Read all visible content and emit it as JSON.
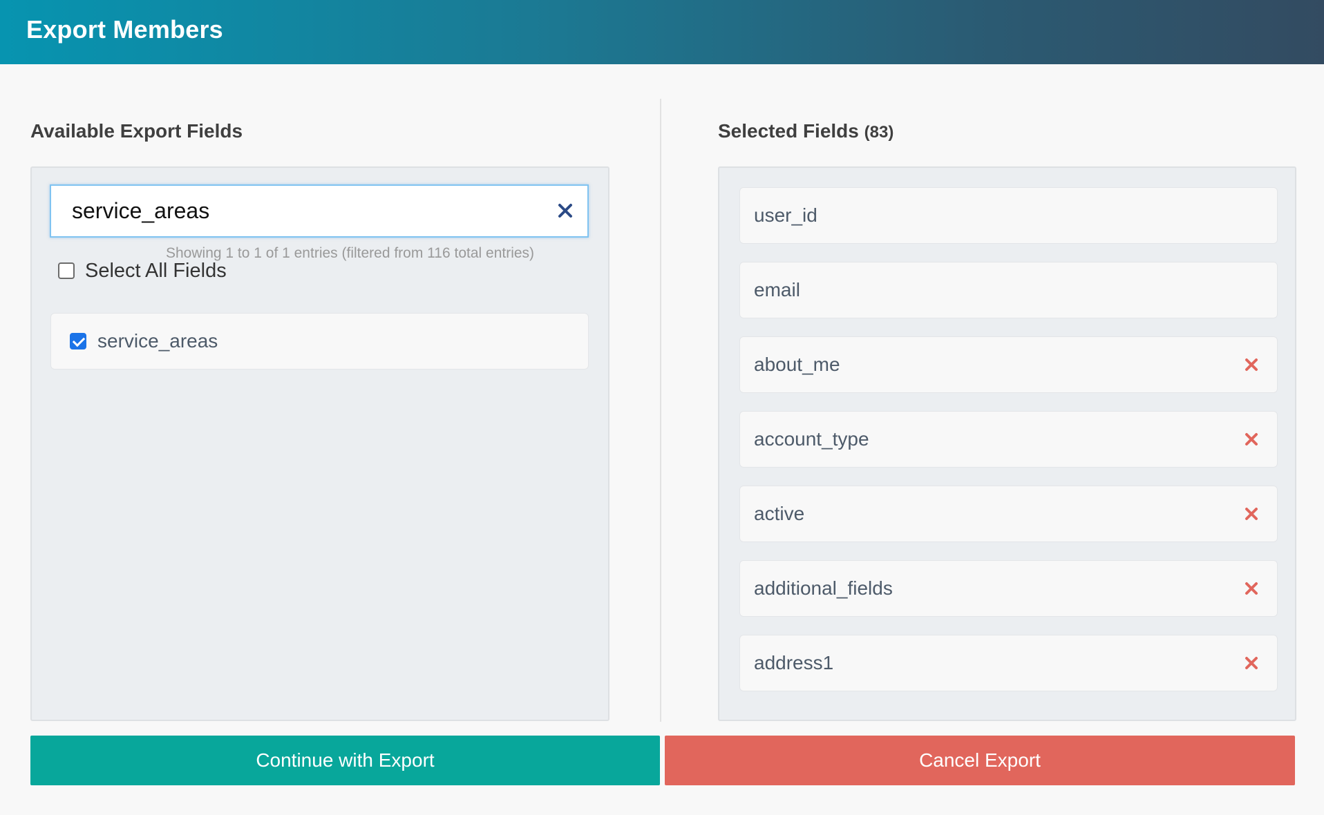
{
  "header": {
    "title": "Export Members"
  },
  "available": {
    "title": "Available Export Fields",
    "search": {
      "value": "service_areas"
    },
    "info": "Showing 1 to 1 of 1 entries (filtered from 116 total entries)",
    "select_all_label": "Select All Fields",
    "select_all_checked": false,
    "items": [
      {
        "label": "service_areas",
        "checked": true
      }
    ]
  },
  "selected": {
    "title": "Selected Fields",
    "count": "(83)",
    "items": [
      {
        "label": "user_id",
        "removable": false
      },
      {
        "label": "email",
        "removable": false
      },
      {
        "label": "about_me",
        "removable": true
      },
      {
        "label": "account_type",
        "removable": true
      },
      {
        "label": "active",
        "removable": true
      },
      {
        "label": "additional_fields",
        "removable": true
      },
      {
        "label": "address1",
        "removable": true
      }
    ]
  },
  "buttons": {
    "continue_label": "Continue with Export",
    "cancel_label": "Cancel Export"
  },
  "colors": {
    "header_start": "#0794b0",
    "header_end": "#334b61",
    "continue": "#08a79b",
    "cancel": "#e1665c",
    "remove_icon": "#e1665c",
    "clear_icon": "#2b4a86"
  },
  "icons": {
    "search_clear": "close-icon",
    "remove": "close-icon"
  }
}
